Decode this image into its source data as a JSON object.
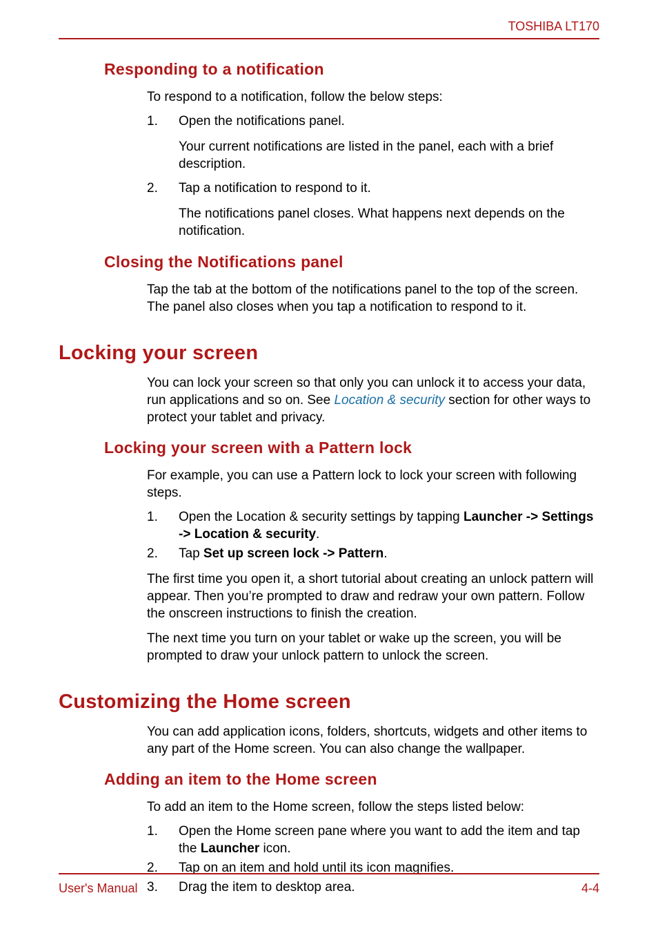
{
  "header": {
    "product": "TOSHIBA LT170"
  },
  "sections": {
    "responding": {
      "title": "Responding to a notification",
      "intro": "To respond to a notification, follow the below steps:",
      "step1": "Open the notifications panel.",
      "step1_sub": "Your current notifications are listed in the panel, each with a brief description.",
      "step2": "Tap a notification to respond to it.",
      "step2_sub": "The notifications panel closes. What happens next depends on the notification."
    },
    "closing": {
      "title": "Closing the Notifications panel",
      "body": "Tap the tab at the bottom of the notifications panel to the top of the screen. The panel also closes when you tap a notification to respond to it."
    },
    "locking": {
      "title": "Locking your screen",
      "body_pre": "You can lock your screen so that only you can unlock it to access your data, run applications and so on. See ",
      "link": "Location & security",
      "body_post": " section for other ways to protect your tablet and privacy."
    },
    "pattern": {
      "title": "Locking your screen with a Pattern lock",
      "intro": "For example, you can use a Pattern lock to lock your screen with following steps.",
      "step1_pre": "Open the Location & security settings by tapping ",
      "step1_bold": "Launcher -> Settings -> Location & security",
      "step1_post": ".",
      "step2_pre": "Tap ",
      "step2_bold": "Set up screen lock -> Pattern",
      "step2_post": ".",
      "para2": "The first time you open it, a short tutorial about creating an unlock pattern will appear. Then you’re prompted to draw and redraw your own pattern. Follow the onscreen instructions to finish the creation.",
      "para3": "The next time you turn on your tablet or wake up the screen, you will be prompted to draw your unlock pattern to unlock the screen."
    },
    "customizing": {
      "title": "Customizing the Home screen",
      "body": "You can add application icons, folders, shortcuts, widgets and other items to any part of the Home screen. You can also change the wallpaper."
    },
    "adding": {
      "title": "Adding an item to the Home screen",
      "intro": "To add an item to the Home screen, follow the steps listed below:",
      "step1_pre": "Open the Home screen pane where you want to add the item and tap the ",
      "step1_bold": "Launcher",
      "step1_post": " icon.",
      "step2": "Tap on an item and hold until its icon magnifies.",
      "step3": "Drag the item to desktop area."
    }
  },
  "list_numbers": {
    "n1": "1.",
    "n2": "2.",
    "n3": "3."
  },
  "footer": {
    "left": "User's Manual",
    "right": "4-4"
  }
}
